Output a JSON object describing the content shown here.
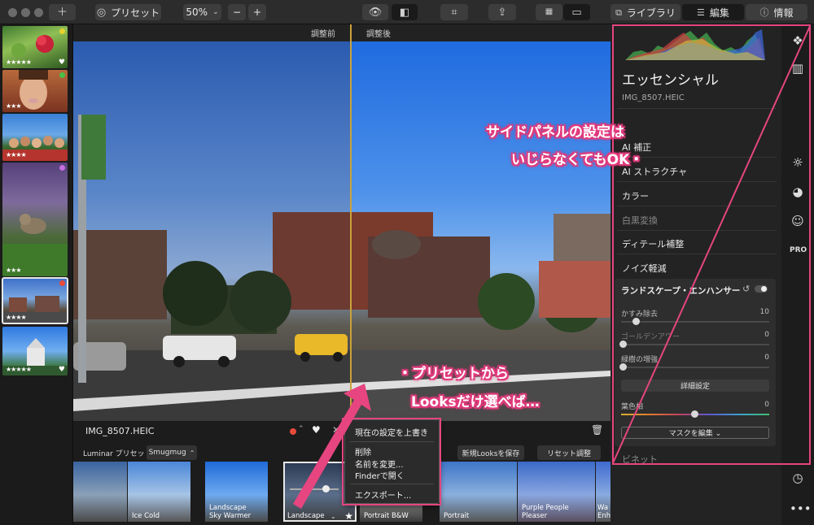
{
  "toolbar": {
    "add_icon": "plus-icon",
    "preset_label": "プリセット",
    "zoom_value": "50%",
    "zoom_out": "−",
    "zoom_in": "+",
    "tab_library": "ライブラリ",
    "tab_edit": "編集",
    "tab_info": "情報"
  },
  "filmstrip": {
    "thumbs": [
      {
        "stars": "★★★★★",
        "heart": "♥",
        "dot": "#e6d22e"
      },
      {
        "stars": "★★★",
        "heart": "",
        "dot": "#46c046"
      },
      {
        "stars": "★★★★",
        "heart": "",
        "dot": ""
      },
      {
        "stars": "★★★",
        "heart": "",
        "dot": "#c86ee0"
      },
      {
        "stars": "★★★★",
        "heart": "",
        "dot": "#e84b3c"
      },
      {
        "stars": "★★★★★",
        "heart": "♥",
        "dot": ""
      }
    ]
  },
  "viewer": {
    "before_label": "調整前",
    "after_label": "調整後"
  },
  "looks": {
    "filename": "IMG_8507.HEIC",
    "category_label": "Luminar プリセット",
    "category_value": "Smugmug",
    "save_looks": "新規Looksを保存",
    "reset": "リセット調整",
    "tiles": [
      "",
      "Ice Cold",
      "Landscape\nSky Warmer",
      "Landscape",
      "Portrait B&W",
      "Portrait",
      "Purple People\nPleaser",
      "Wa\nEnh"
    ]
  },
  "context_menu": {
    "overwrite": "現在の設定を上書き",
    "delete": "削除",
    "rename": "名前を変更...",
    "finder": "Finderで開く",
    "export": "エクスポート..."
  },
  "panel": {
    "title": "エッセンシャル",
    "filename": "IMG_8507.HEIC",
    "items": [
      "AI 補正",
      "AI ストラクチャ",
      "カラー",
      "白黒変換",
      "ディテール補整",
      "ノイズ軽減"
    ],
    "subpanel": {
      "title": "ランドスケープ・エンハンサー",
      "haze_label": "かすみ除去",
      "haze_value": "10",
      "golden_label": "ゴールデンアワー",
      "golden_value": "0",
      "foliage_label": "緑樹の増強",
      "foliage_value": "0",
      "advanced": "詳細設定",
      "leaf_label": "葉色相",
      "leaf_value": "0",
      "mask": "マスクを編集 ⌄"
    },
    "vignette": "ビネット"
  },
  "annotations": {
    "side_line1": "サイドパネルの設定は",
    "side_line2": "いじらなくてもOK・",
    "bottom_line1": "・プリセットから",
    "bottom_line2": "Looksだけ選べば…"
  },
  "colors": {
    "accent": "#e6457f",
    "split": "#c9a23a",
    "annotation_pink": "#e23c7e"
  }
}
